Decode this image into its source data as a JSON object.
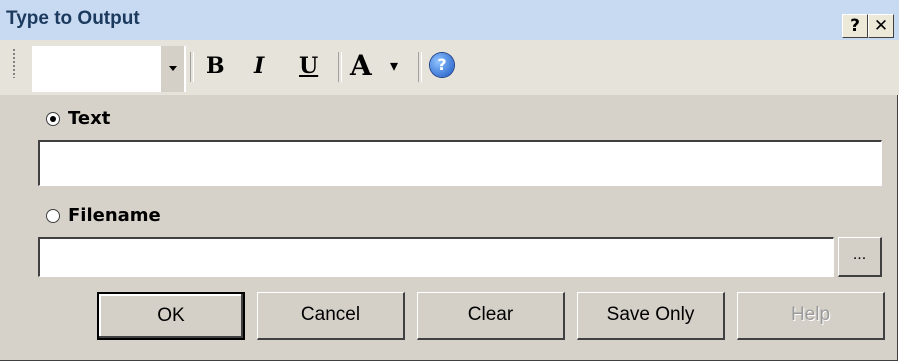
{
  "window": {
    "title": "Type to Output",
    "help_button": "?",
    "close_button": "✕"
  },
  "toolbar": {
    "font_value": "",
    "bold_label": "B",
    "italic_label": "I",
    "underline_label": "U",
    "font_color_label": "A",
    "font_color_dropdown": "▾",
    "help_icon": "?"
  },
  "options": {
    "text_label": "Text",
    "text_selected": true,
    "text_value": "",
    "filename_label": "Filename",
    "filename_selected": false,
    "filename_value": "",
    "browse_label": "..."
  },
  "buttons": {
    "ok": "OK",
    "cancel": "Cancel",
    "clear": "Clear",
    "save_only": "Save Only",
    "help": "Help"
  },
  "colors": {
    "title_bar": "#c8daf2",
    "dialog_bg": "#d6d2c9",
    "disabled_text": "#9a9a9a"
  }
}
